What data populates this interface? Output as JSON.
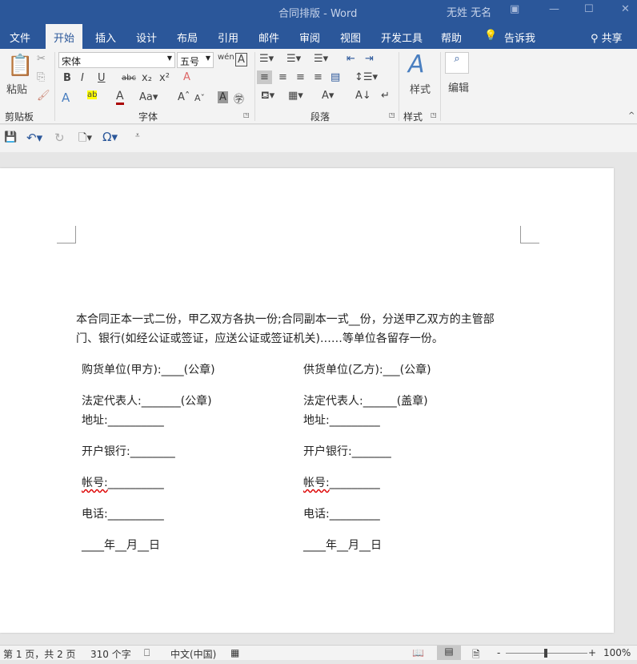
{
  "window": {
    "title": "合同排版 - Word",
    "user": "无姓 无名"
  },
  "tabs": [
    {
      "label": "文件"
    },
    {
      "label": "开始"
    },
    {
      "label": "插入"
    },
    {
      "label": "设计"
    },
    {
      "label": "布局"
    },
    {
      "label": "引用"
    },
    {
      "label": "邮件"
    },
    {
      "label": "审阅"
    },
    {
      "label": "视图"
    },
    {
      "label": "开发工具"
    },
    {
      "label": "帮助"
    },
    {
      "label": "告诉我"
    }
  ],
  "share": "共享",
  "ribbon": {
    "paste": "粘贴",
    "clipboard": "剪贴板",
    "font_name": "宋体",
    "font_size": "五号",
    "font_group": "字体",
    "paragraph_group": "段落",
    "styles": "样式",
    "styles_group": "样式",
    "edit": "编辑"
  },
  "document": {
    "intro": [
      "本合同正本一式二份，甲乙双方各执一份;合同副本一式__份，分送甲乙双方的主管部",
      "门、银行(如经公证或签证，应送公证或签证机关)……等单位各留存一份。"
    ],
    "left": [
      "购货单位(甲方):____(公章)",
      "法定代表人:_______(公章)",
      "地址:__________",
      "开户银行:________",
      "帐号:",
      "__________",
      "电话:__________",
      "____年__月__日"
    ],
    "right": [
      "供货单位(乙方):___(公章)",
      "法定代表人:______(盖章)",
      "地址:_________",
      "开户银行:_______",
      "帐号:",
      "_________",
      "电话:_________",
      "____年__月__日"
    ]
  },
  "status": {
    "page": "第 1 页，共 2 页",
    "words": "310 个字",
    "language": "中文(中国)",
    "zoom": "100%",
    "zoom_percent": 100
  }
}
